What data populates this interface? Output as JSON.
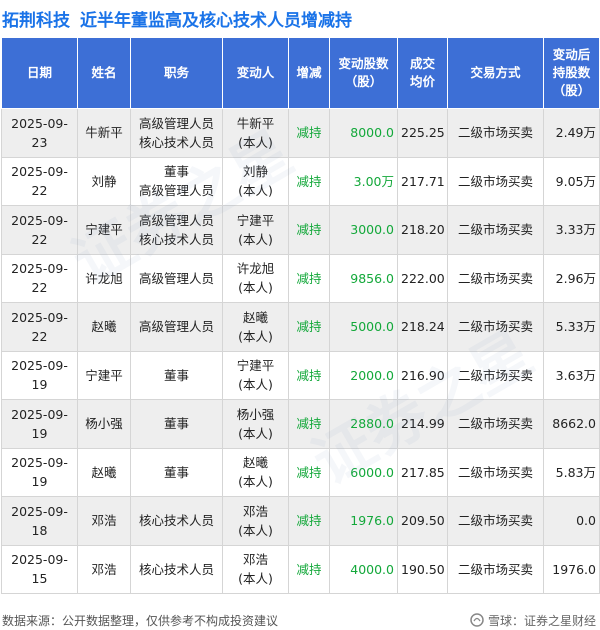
{
  "header": {
    "company": "拓荆科技",
    "title": "近半年董监高及核心技术人员增减持"
  },
  "table": {
    "columns": [
      "日期",
      "姓名",
      "职务",
      "变动人",
      "增减",
      "变动股数\n（股）",
      "成交\n均价",
      "交易方式",
      "变动后\n持股数\n（股）"
    ],
    "rows": [
      {
        "date": "2025-09-23",
        "name": "牛新平",
        "position": [
          "高级管理人员",
          "核心技术人员"
        ],
        "person": [
          "牛新平",
          "(本人)"
        ],
        "change": "减持",
        "shares": "8000.0",
        "price": "225.25",
        "method": "二级市场买卖",
        "after": "2.49万"
      },
      {
        "date": "2025-09-22",
        "name": "刘静",
        "position": [
          "董事",
          "高级管理人员"
        ],
        "person": [
          "刘静",
          "(本人)"
        ],
        "change": "减持",
        "shares": "3.00万",
        "price": "217.71",
        "method": "二级市场买卖",
        "after": "9.05万"
      },
      {
        "date": "2025-09-22",
        "name": "宁建平",
        "position": [
          "高级管理人员",
          "核心技术人员"
        ],
        "person": [
          "宁建平",
          "(本人)"
        ],
        "change": "减持",
        "shares": "3000.0",
        "price": "218.20",
        "method": "二级市场买卖",
        "after": "3.33万"
      },
      {
        "date": "2025-09-22",
        "name": "许龙旭",
        "position": [
          "高级管理人员"
        ],
        "person": [
          "许龙旭",
          "(本人)"
        ],
        "change": "减持",
        "shares": "9856.0",
        "price": "222.00",
        "method": "二级市场买卖",
        "after": "2.96万"
      },
      {
        "date": "2025-09-22",
        "name": "赵曦",
        "position": [
          "高级管理人员"
        ],
        "person": [
          "赵曦",
          "(本人)"
        ],
        "change": "减持",
        "shares": "5000.0",
        "price": "218.24",
        "method": "二级市场买卖",
        "after": "5.33万"
      },
      {
        "date": "2025-09-19",
        "name": "宁建平",
        "position": [
          "董事"
        ],
        "person": [
          "宁建平",
          "(本人)"
        ],
        "change": "减持",
        "shares": "2000.0",
        "price": "216.90",
        "method": "二级市场买卖",
        "after": "3.63万"
      },
      {
        "date": "2025-09-19",
        "name": "杨小强",
        "position": [
          "董事"
        ],
        "person": [
          "杨小强",
          "(本人)"
        ],
        "change": "减持",
        "shares": "2880.0",
        "price": "214.99",
        "method": "二级市场买卖",
        "after": "8662.0"
      },
      {
        "date": "2025-09-19",
        "name": "赵曦",
        "position": [
          "董事"
        ],
        "person": [
          "赵曦",
          "(本人)"
        ],
        "change": "减持",
        "shares": "6000.0",
        "price": "217.85",
        "method": "二级市场买卖",
        "after": "5.83万"
      },
      {
        "date": "2025-09-18",
        "name": "邓浩",
        "position": [
          "核心技术人员"
        ],
        "person": [
          "邓浩",
          "(本人)"
        ],
        "change": "减持",
        "shares": "1976.0",
        "price": "209.50",
        "method": "二级市场买卖",
        "after": "0.0"
      },
      {
        "date": "2025-09-15",
        "name": "邓浩",
        "position": [
          "核心技术人员"
        ],
        "person": [
          "邓浩",
          "(本人)"
        ],
        "change": "减持",
        "shares": "4000.0",
        "price": "190.50",
        "method": "二级市场买卖",
        "after": "1976.0"
      }
    ]
  },
  "footer": {
    "note": "数据来源：公开数据整理，仅供参考不构成投资建议",
    "brand": "雪球：证券之星财经",
    "brand_icon": "snowball-icon"
  },
  "watermark": "证券之星",
  "colors": {
    "title": "#1a73e8",
    "header_bg": "#3d6fd6",
    "decrease": "#13a83a",
    "row_alt": "#eeeeee"
  }
}
